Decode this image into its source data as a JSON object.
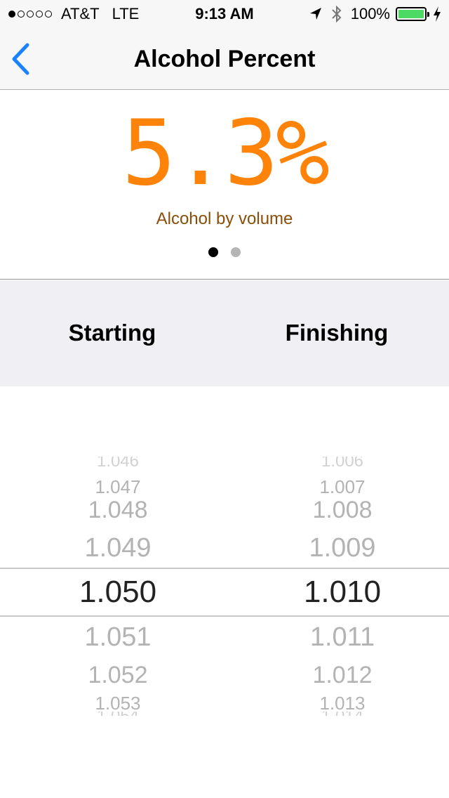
{
  "status_bar": {
    "carrier": "AT&T",
    "network": "LTE",
    "time": "9:13 AM",
    "battery": "100%",
    "battery_level": 1.0,
    "signal_bars": 1,
    "icons": [
      "location-arrow-icon",
      "bluetooth-icon",
      "battery-icon",
      "charging-bolt-icon"
    ]
  },
  "nav": {
    "back_icon": "chevron-left-icon",
    "title": "Alcohol Percent"
  },
  "result": {
    "value": "5.3%",
    "label": "Alcohol by volume",
    "page_count": 2,
    "active_page": 1
  },
  "columns": {
    "starting_label": "Starting",
    "finishing_label": "Finishing"
  },
  "picker": {
    "starting": {
      "above": [
        "1.047",
        "1.048",
        "1.049"
      ],
      "selected": "1.050",
      "below": [
        "1.051",
        "1.052",
        "1.053"
      ]
    },
    "finishing": {
      "above": [
        "1.007",
        "1.008",
        "1.009"
      ],
      "selected": "1.010",
      "below": [
        "1.011",
        "1.012",
        "1.013"
      ]
    }
  },
  "colors": {
    "accent_orange": "#ff8209",
    "label_brown": "#8a4e0a",
    "ios_blue": "#1a82fb",
    "battery_green": "#4cd964"
  }
}
